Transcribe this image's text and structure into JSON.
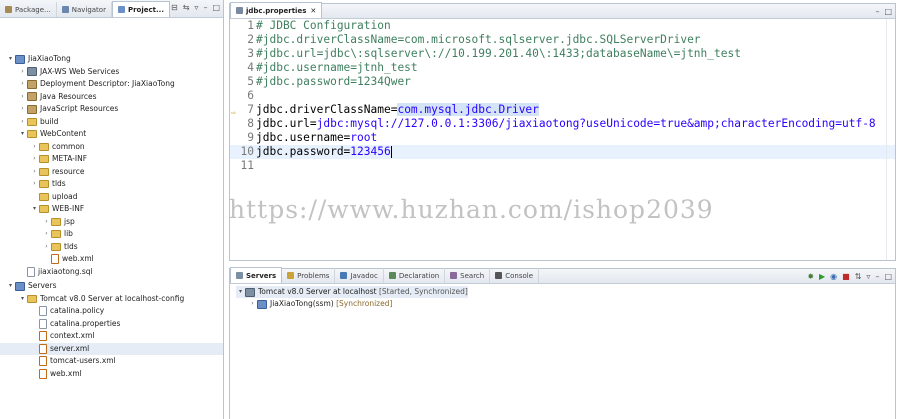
{
  "explorer": {
    "tabs": [
      "Package...",
      "Navigator",
      "Project..."
    ],
    "tree": [
      {
        "label": "JiaXiaoTong",
        "level": 0,
        "expanded": true,
        "icon": "project"
      },
      {
        "label": "JAX-WS Web Services",
        "level": 1,
        "expanded": false,
        "icon": "webservice"
      },
      {
        "label": "Deployment Descriptor: JiaXiaoTong",
        "level": 1,
        "expanded": false,
        "icon": "descriptor"
      },
      {
        "label": "Java Resources",
        "level": 1,
        "expanded": false,
        "icon": "java"
      },
      {
        "label": "JavaScript Resources",
        "level": 1,
        "expanded": false,
        "icon": "javascript"
      },
      {
        "label": "build",
        "level": 1,
        "expanded": false,
        "icon": "folder"
      },
      {
        "label": "WebContent",
        "level": 1,
        "expanded": true,
        "icon": "folder"
      },
      {
        "label": "common",
        "level": 2,
        "expanded": false,
        "icon": "folder"
      },
      {
        "label": "META-INF",
        "level": 2,
        "expanded": false,
        "icon": "folder"
      },
      {
        "label": "resource",
        "level": 2,
        "expanded": false,
        "icon": "folder"
      },
      {
        "label": "tlds",
        "level": 2,
        "expanded": false,
        "icon": "folder"
      },
      {
        "label": "upload",
        "level": 2,
        "expanded": null,
        "icon": "folder"
      },
      {
        "label": "WEB-INF",
        "level": 2,
        "expanded": true,
        "icon": "folder"
      },
      {
        "label": "jsp",
        "level": 3,
        "expanded": false,
        "icon": "folder"
      },
      {
        "label": "lib",
        "level": 3,
        "expanded": false,
        "icon": "folder"
      },
      {
        "label": "tlds",
        "level": 3,
        "expanded": false,
        "icon": "folder"
      },
      {
        "label": "web.xml",
        "level": 3,
        "expanded": null,
        "icon": "xml"
      },
      {
        "label": "jiaxiaotong.sql",
        "level": 1,
        "expanded": null,
        "icon": "file"
      },
      {
        "label": "Servers",
        "level": 0,
        "expanded": true,
        "icon": "project"
      },
      {
        "label": "Tomcat v8.0 Server at localhost-config",
        "level": 1,
        "expanded": true,
        "icon": "folder"
      },
      {
        "label": "catalina.policy",
        "level": 2,
        "expanded": null,
        "icon": "file"
      },
      {
        "label": "catalina.properties",
        "level": 2,
        "expanded": null,
        "icon": "file"
      },
      {
        "label": "context.xml",
        "level": 2,
        "expanded": null,
        "icon": "xml"
      },
      {
        "label": "server.xml",
        "level": 2,
        "expanded": null,
        "icon": "xml",
        "selected": true
      },
      {
        "label": "tomcat-users.xml",
        "level": 2,
        "expanded": null,
        "icon": "xml"
      },
      {
        "label": "web.xml",
        "level": 2,
        "expanded": null,
        "icon": "xml"
      }
    ]
  },
  "editor": {
    "tab": "jdbc.properties",
    "lines": [
      {
        "n": "1",
        "parts": [
          {
            "t": "# JDBC Configuration",
            "c": "cmt"
          }
        ]
      },
      {
        "n": "2",
        "parts": [
          {
            "t": "#jdbc.driverClassName=com.microsoft.sqlserver.jdbc.SQLServerDriver",
            "c": "cmt"
          }
        ]
      },
      {
        "n": "3",
        "parts": [
          {
            "t": "#jdbc.url=jdbc\\:sqlserver\\://10.199.201.40\\:1433;databaseName\\=jtnh_test",
            "c": "cmt"
          }
        ]
      },
      {
        "n": "4",
        "parts": [
          {
            "t": "#jdbc.username=jtnh_test",
            "c": "cmt"
          }
        ]
      },
      {
        "n": "5",
        "parts": [
          {
            "t": "#jdbc.password=1234Qwer",
            "c": "cmt"
          }
        ]
      },
      {
        "n": "6",
        "parts": []
      },
      {
        "n": "7",
        "marker": true,
        "parts": [
          {
            "t": "jdbc.driverClassName=",
            "c": "key"
          },
          {
            "t": "com.mysql.jdbc.Driver",
            "c": "val hl"
          }
        ]
      },
      {
        "n": "8",
        "parts": [
          {
            "t": "jdbc.url=",
            "c": "key"
          },
          {
            "t": "jdbc:mysql://127.0.0.1:3306/jiaxiaotong?useUnicode=true&amp;characterEncoding=utf-8",
            "c": "val"
          }
        ]
      },
      {
        "n": "9",
        "parts": [
          {
            "t": "jdbc.username=",
            "c": "key"
          },
          {
            "t": "root",
            "c": "val"
          }
        ]
      },
      {
        "n": "10",
        "current": true,
        "parts": [
          {
            "t": "jdbc.password=",
            "c": "key"
          },
          {
            "t": "123456",
            "c": "val"
          }
        ]
      },
      {
        "n": "11",
        "parts": []
      }
    ],
    "watermark": "https://www.huzhan.com/ishop2039"
  },
  "servers_view": {
    "tabs": [
      "Servers",
      "Problems",
      "Javadoc",
      "Declaration",
      "Search",
      "Console"
    ],
    "server": {
      "name": "Tomcat v8.0 Server at localhost",
      "status": "[Started, Synchronized]"
    },
    "module": {
      "name": "JiaXiaoTong(ssm)",
      "status": "[Synchronized]"
    }
  }
}
